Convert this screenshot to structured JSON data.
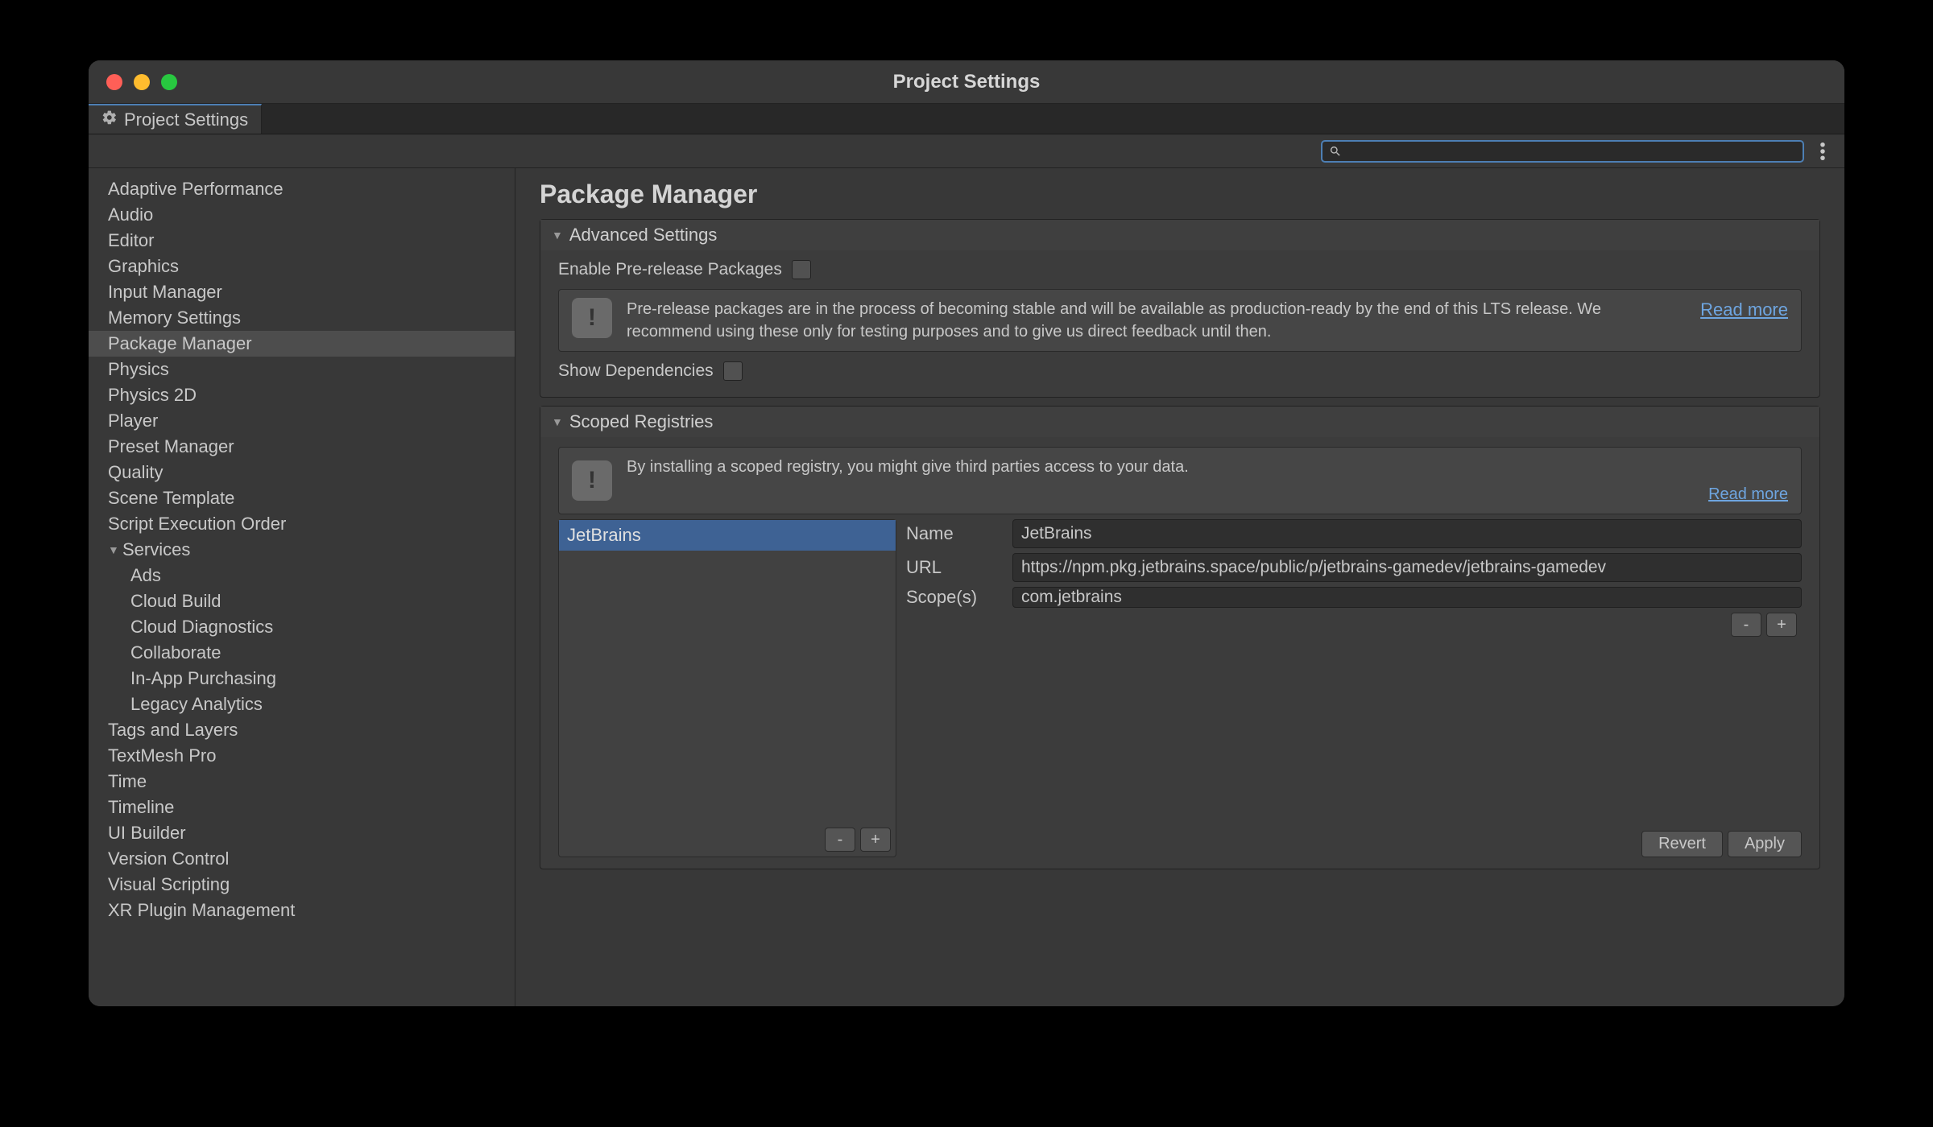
{
  "window": {
    "title": "Project Settings"
  },
  "tab": {
    "label": "Project Settings"
  },
  "search": {
    "value": ""
  },
  "sidebar": {
    "items": [
      {
        "label": "Adaptive Performance"
      },
      {
        "label": "Audio"
      },
      {
        "label": "Editor"
      },
      {
        "label": "Graphics"
      },
      {
        "label": "Input Manager"
      },
      {
        "label": "Memory Settings"
      },
      {
        "label": "Package Manager",
        "selected": true
      },
      {
        "label": "Physics"
      },
      {
        "label": "Physics 2D"
      },
      {
        "label": "Player"
      },
      {
        "label": "Preset Manager"
      },
      {
        "label": "Quality"
      },
      {
        "label": "Scene Template"
      },
      {
        "label": "Script Execution Order"
      },
      {
        "label": "Services",
        "expandable": true
      },
      {
        "label": "Ads",
        "indent": 1
      },
      {
        "label": "Cloud Build",
        "indent": 1
      },
      {
        "label": "Cloud Diagnostics",
        "indent": 1
      },
      {
        "label": "Collaborate",
        "indent": 1
      },
      {
        "label": "In-App Purchasing",
        "indent": 1
      },
      {
        "label": "Legacy Analytics",
        "indent": 1
      },
      {
        "label": "Tags and Layers"
      },
      {
        "label": "TextMesh Pro"
      },
      {
        "label": "Time"
      },
      {
        "label": "Timeline"
      },
      {
        "label": "UI Builder"
      },
      {
        "label": "Version Control"
      },
      {
        "label": "Visual Scripting"
      },
      {
        "label": "XR Plugin Management"
      }
    ]
  },
  "content": {
    "title": "Package Manager",
    "advanced": {
      "header": "Advanced Settings",
      "enable_pre": "Enable Pre-release Packages",
      "info": "Pre-release packages are in the process of becoming stable and will be available as production-ready by the end of this LTS release. We recommend using these only for testing purposes and to give us direct feedback until then.",
      "read_more": "Read more",
      "show_deps": "Show Dependencies"
    },
    "scoped": {
      "header": "Scoped Registries",
      "info": "By installing a scoped registry, you might give third parties access to your data.",
      "read_more": "Read more",
      "registries": [
        {
          "name": "JetBrains"
        }
      ],
      "form": {
        "name_label": "Name",
        "name_value": "JetBrains",
        "url_label": "URL",
        "url_value": "https://npm.pkg.jetbrains.space/public/p/jetbrains-gamedev/jetbrains-gamedev",
        "scope_label": "Scope(s)",
        "scope_value": "com.jetbrains"
      },
      "buttons": {
        "remove": "-",
        "add": "+",
        "scope_remove": "-",
        "scope_add": "+",
        "revert": "Revert",
        "apply": "Apply"
      }
    }
  }
}
